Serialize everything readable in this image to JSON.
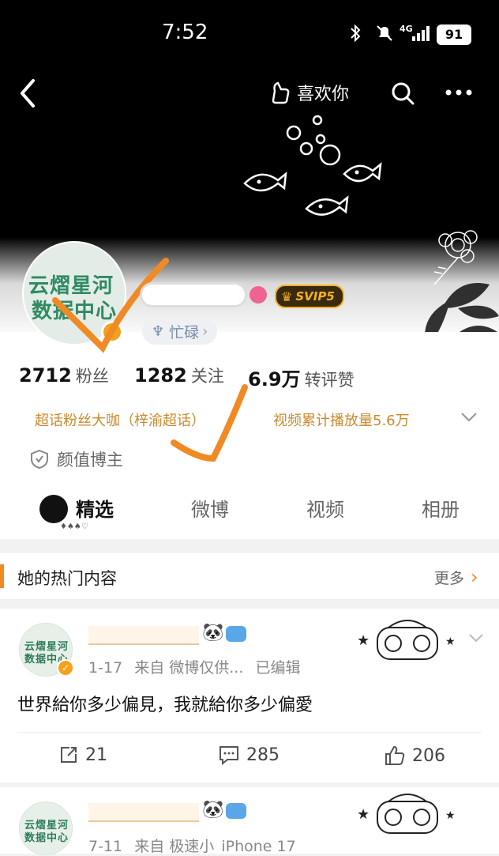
{
  "status": {
    "time": "7:52",
    "network": "4G",
    "battery": "91"
  },
  "top_bar": {
    "like_label": "喜欢你"
  },
  "profile": {
    "verified_badge": "SVIP5",
    "status_tag": "忙碌",
    "avatar_text_line1": "云熠星河",
    "avatar_text_line2": "数据中心",
    "stats": [
      {
        "num": "2712",
        "label": "粉丝"
      },
      {
        "num": "1282",
        "label": "关注"
      },
      {
        "num": "6.9万",
        "label": "转评赞"
      }
    ],
    "achievement_left": "超话粉丝大咖（梓渝超话）",
    "achievement_right": "视频累计播放量5.6万",
    "role_label": "颜值博主",
    "tabs": [
      "精选",
      "微博",
      "视频",
      "相册"
    ]
  },
  "hot_section": {
    "title": "她的热门内容",
    "more_label": "更多"
  },
  "posts": [
    {
      "date": "1-17",
      "source": "来自 微博仅供...",
      "edited": "已编辑",
      "text": "世界給你多少偏見，我就給你多少偏愛",
      "reposts": "21",
      "comments": "285",
      "likes": "206"
    },
    {
      "date": "7-11",
      "source": "来自 极速小",
      "source_device": "iPhone 17"
    }
  ],
  "colors": {
    "accent": "#f08a24",
    "achievement": "#c98a2e",
    "svip": "#f3b21e"
  }
}
